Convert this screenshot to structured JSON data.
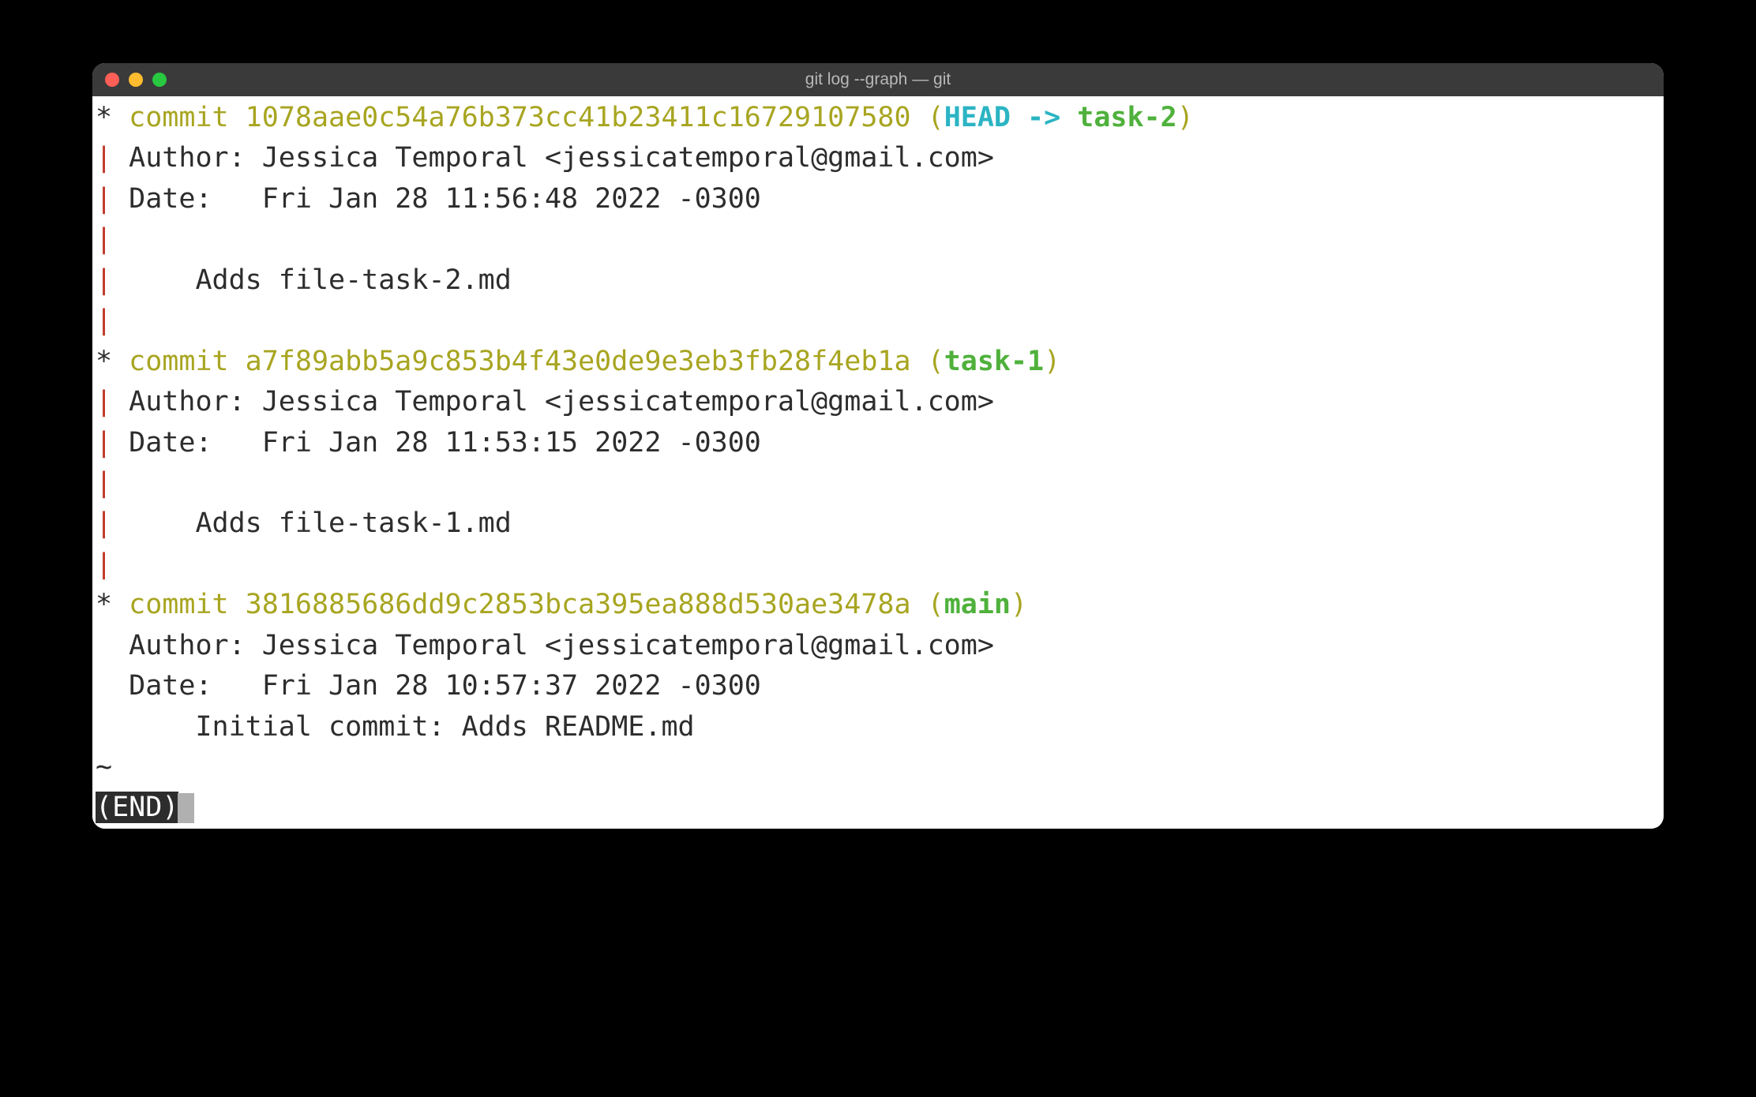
{
  "window": {
    "title": "git log --graph — git"
  },
  "commits": [
    {
      "graph_star": "* ",
      "commit_label": "commit 1078aae0c54a76b373cc41b23411c16729107580 ",
      "ref_open": "(",
      "head_text": "HEAD -> ",
      "branch_text": "task-2",
      "ref_close": ")",
      "pipe": "| ",
      "author": "Author: Jessica Temporal <jessicatemporal@gmail.com>",
      "date": "Date:   Fri Jan 28 11:56:48 2022 -0300",
      "blank_pipe": "|",
      "msg_pipe": "| ",
      "message": "    Adds file-task-2.md",
      "trailing_pipe": "|"
    },
    {
      "graph_star": "* ",
      "commit_label": "commit a7f89abb5a9c853b4f43e0de9e3eb3fb28f4eb1a ",
      "ref_open": "(",
      "branch_text": "task-1",
      "ref_close": ")",
      "pipe": "| ",
      "author": "Author: Jessica Temporal <jessicatemporal@gmail.com>",
      "date": "Date:   Fri Jan 28 11:53:15 2022 -0300",
      "blank_pipe": "|",
      "msg_pipe": "| ",
      "message": "    Adds file-task-1.md",
      "trailing_pipe": "|"
    },
    {
      "graph_star": "* ",
      "commit_label": "commit 3816885686dd9c2853bca395ea888d530ae3478a ",
      "ref_open": "(",
      "branch_text": "main",
      "ref_close": ")",
      "indent": "  ",
      "author": "Author: Jessica Temporal <jessicatemporal@gmail.com>",
      "date": "Date:   Fri Jan 28 10:57:37 2022 -0300",
      "blank_line": "",
      "message": "      Initial commit: Adds README.md"
    }
  ],
  "pager": {
    "tilde": "~",
    "end": "(END)"
  }
}
